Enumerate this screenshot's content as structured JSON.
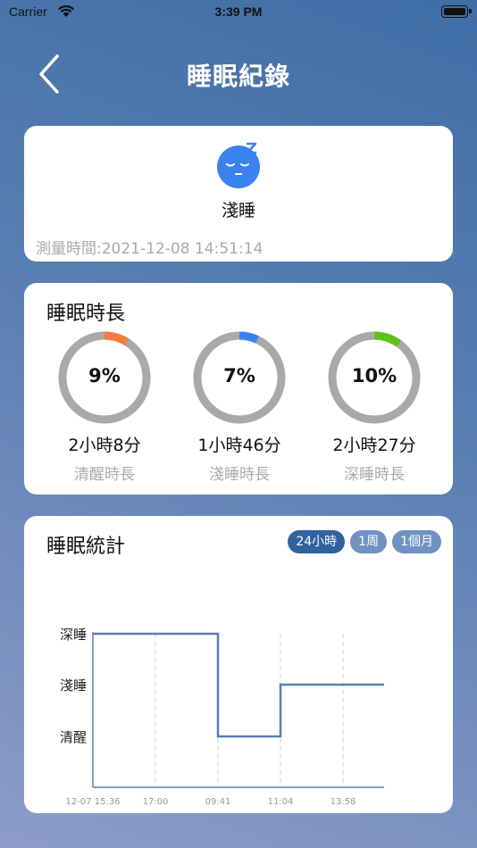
{
  "status_bar": {
    "carrier": "Carrier",
    "time": "3:39 PM"
  },
  "nav": {
    "title": "睡眠紀錄"
  },
  "summary": {
    "state": "淺睡",
    "measure_time": "測量時間:2021-12-08 14:51:14"
  },
  "duration": {
    "title": "睡眠時長",
    "rings": [
      {
        "percent": "9%",
        "fraction": 0.09,
        "duration": "2小時8分",
        "label": "清醒時長",
        "color": "#f57c3a"
      },
      {
        "percent": "7%",
        "fraction": 0.07,
        "duration": "1小時46分",
        "label": "淺睡時長",
        "color": "#3b82f0"
      },
      {
        "percent": "10%",
        "fraction": 0.1,
        "duration": "2小時27分",
        "label": "深睡時長",
        "color": "#5ec21a"
      }
    ]
  },
  "stats": {
    "title": "睡眠統計",
    "tabs": [
      {
        "label": "24小時",
        "active": true
      },
      {
        "label": "1周",
        "active": false
      },
      {
        "label": "1個月",
        "active": false
      }
    ]
  },
  "chart_data": {
    "type": "line",
    "y_categories": [
      "清醒",
      "淺睡",
      "深睡"
    ],
    "x_ticks": [
      "12-07 15:36",
      "17:00",
      "09:41",
      "11:04",
      "13:58"
    ],
    "series": [
      {
        "points": [
          {
            "x": "12-07 15:36",
            "y": "深睡"
          },
          {
            "x": "09:41",
            "y": "深睡"
          },
          {
            "x": "09:41",
            "y": "清醒"
          },
          {
            "x": "11:04",
            "y": "清醒"
          },
          {
            "x": "11:04",
            "y": "淺睡"
          },
          {
            "x": "13:58",
            "y": "淺睡"
          }
        ]
      }
    ],
    "line_color": "#5b7fb3"
  }
}
